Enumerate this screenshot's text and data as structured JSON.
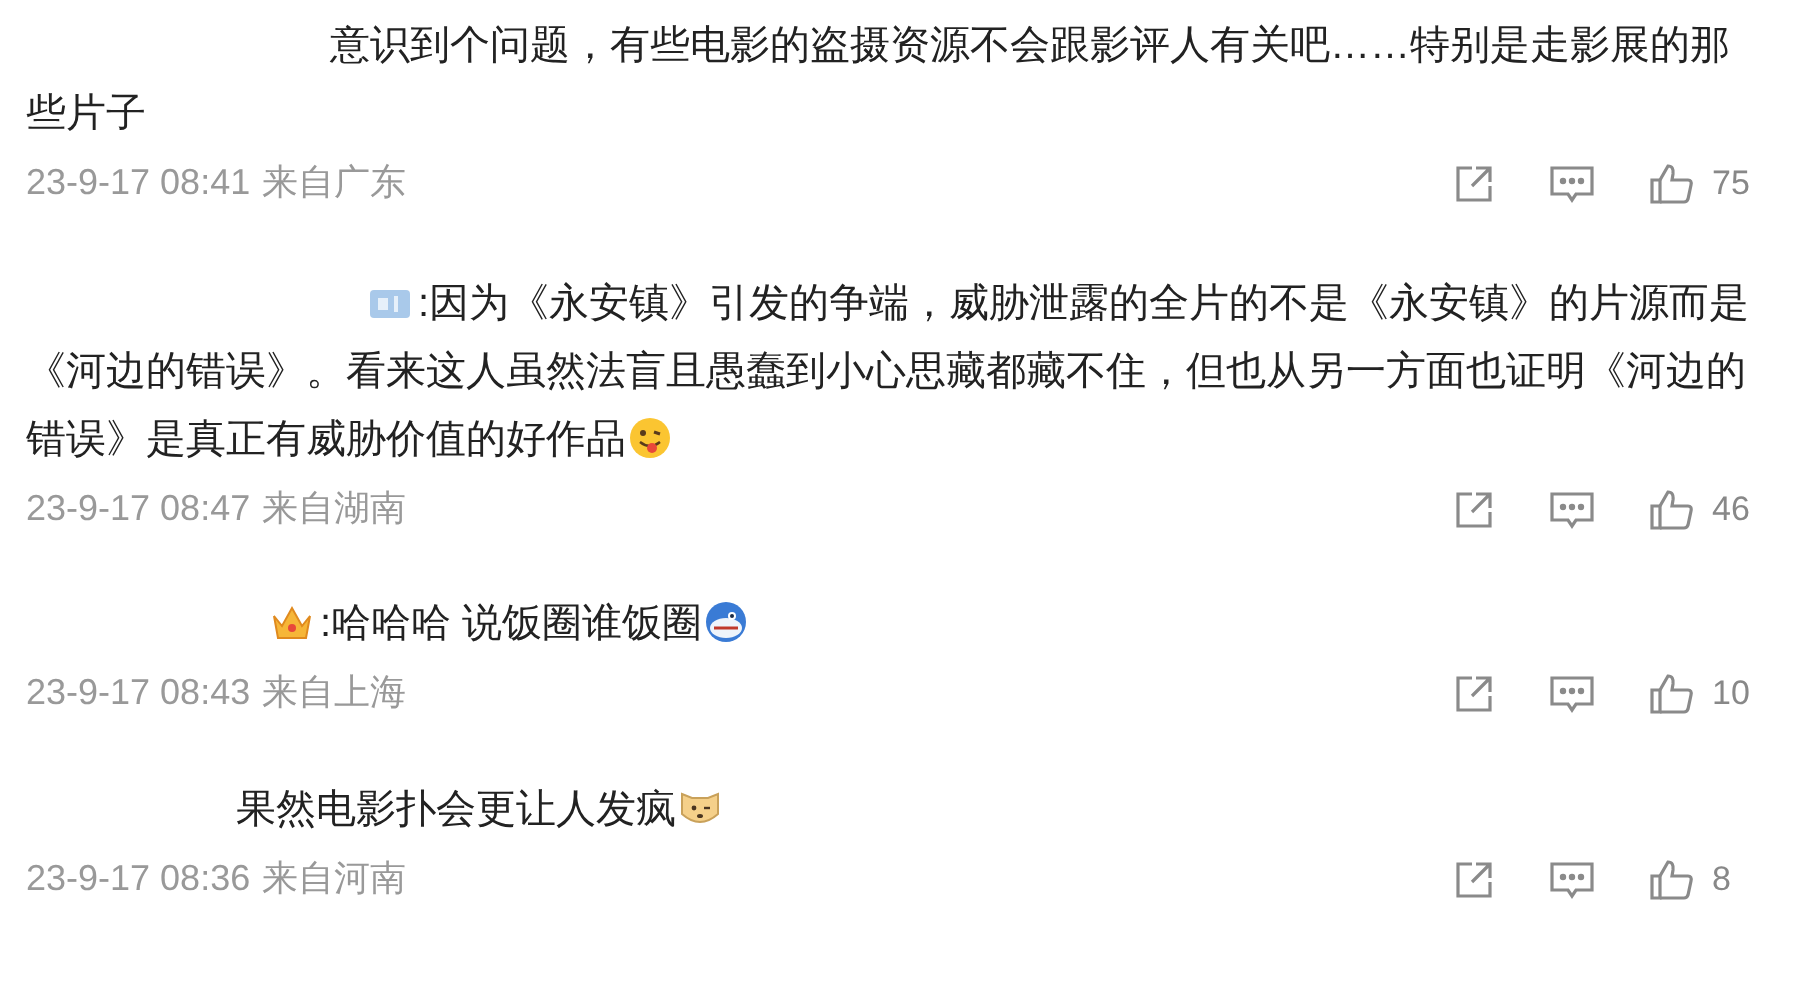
{
  "comments": [
    {
      "text": "意识到个问题，有些电影的盗摄资源不会跟影评人有关吧……特别是走影展的那些片子",
      "time": "23-9-17 08:41",
      "location": "来自广东",
      "likes": "75"
    },
    {
      "lead": {
        "kind": "badge"
      },
      "text": ":因为《永安镇》引发的争端，威胁泄露的全片的不是《永安镇》的片源而是《河边的错误》。看来这人虽然法盲且愚蠢到小心思藏都藏不住，但也从另一方面也证明《河边的错误》是真正有威胁价值的好作品",
      "trail": {
        "kind": "tongue"
      },
      "time": "23-9-17 08:47",
      "location": "来自湖南",
      "likes": "46"
    },
    {
      "lead": {
        "kind": "crown"
      },
      "text": ":哈哈哈 说饭圈谁饭圈",
      "trail": {
        "kind": "shark"
      },
      "time": "23-9-17 08:43",
      "location": "来自上海",
      "likes": "10"
    },
    {
      "text": "果然电影扑会更让人发疯",
      "trail": {
        "kind": "dog"
      },
      "time": "23-9-17 08:36",
      "location": "来自河南",
      "likes": "8"
    }
  ]
}
